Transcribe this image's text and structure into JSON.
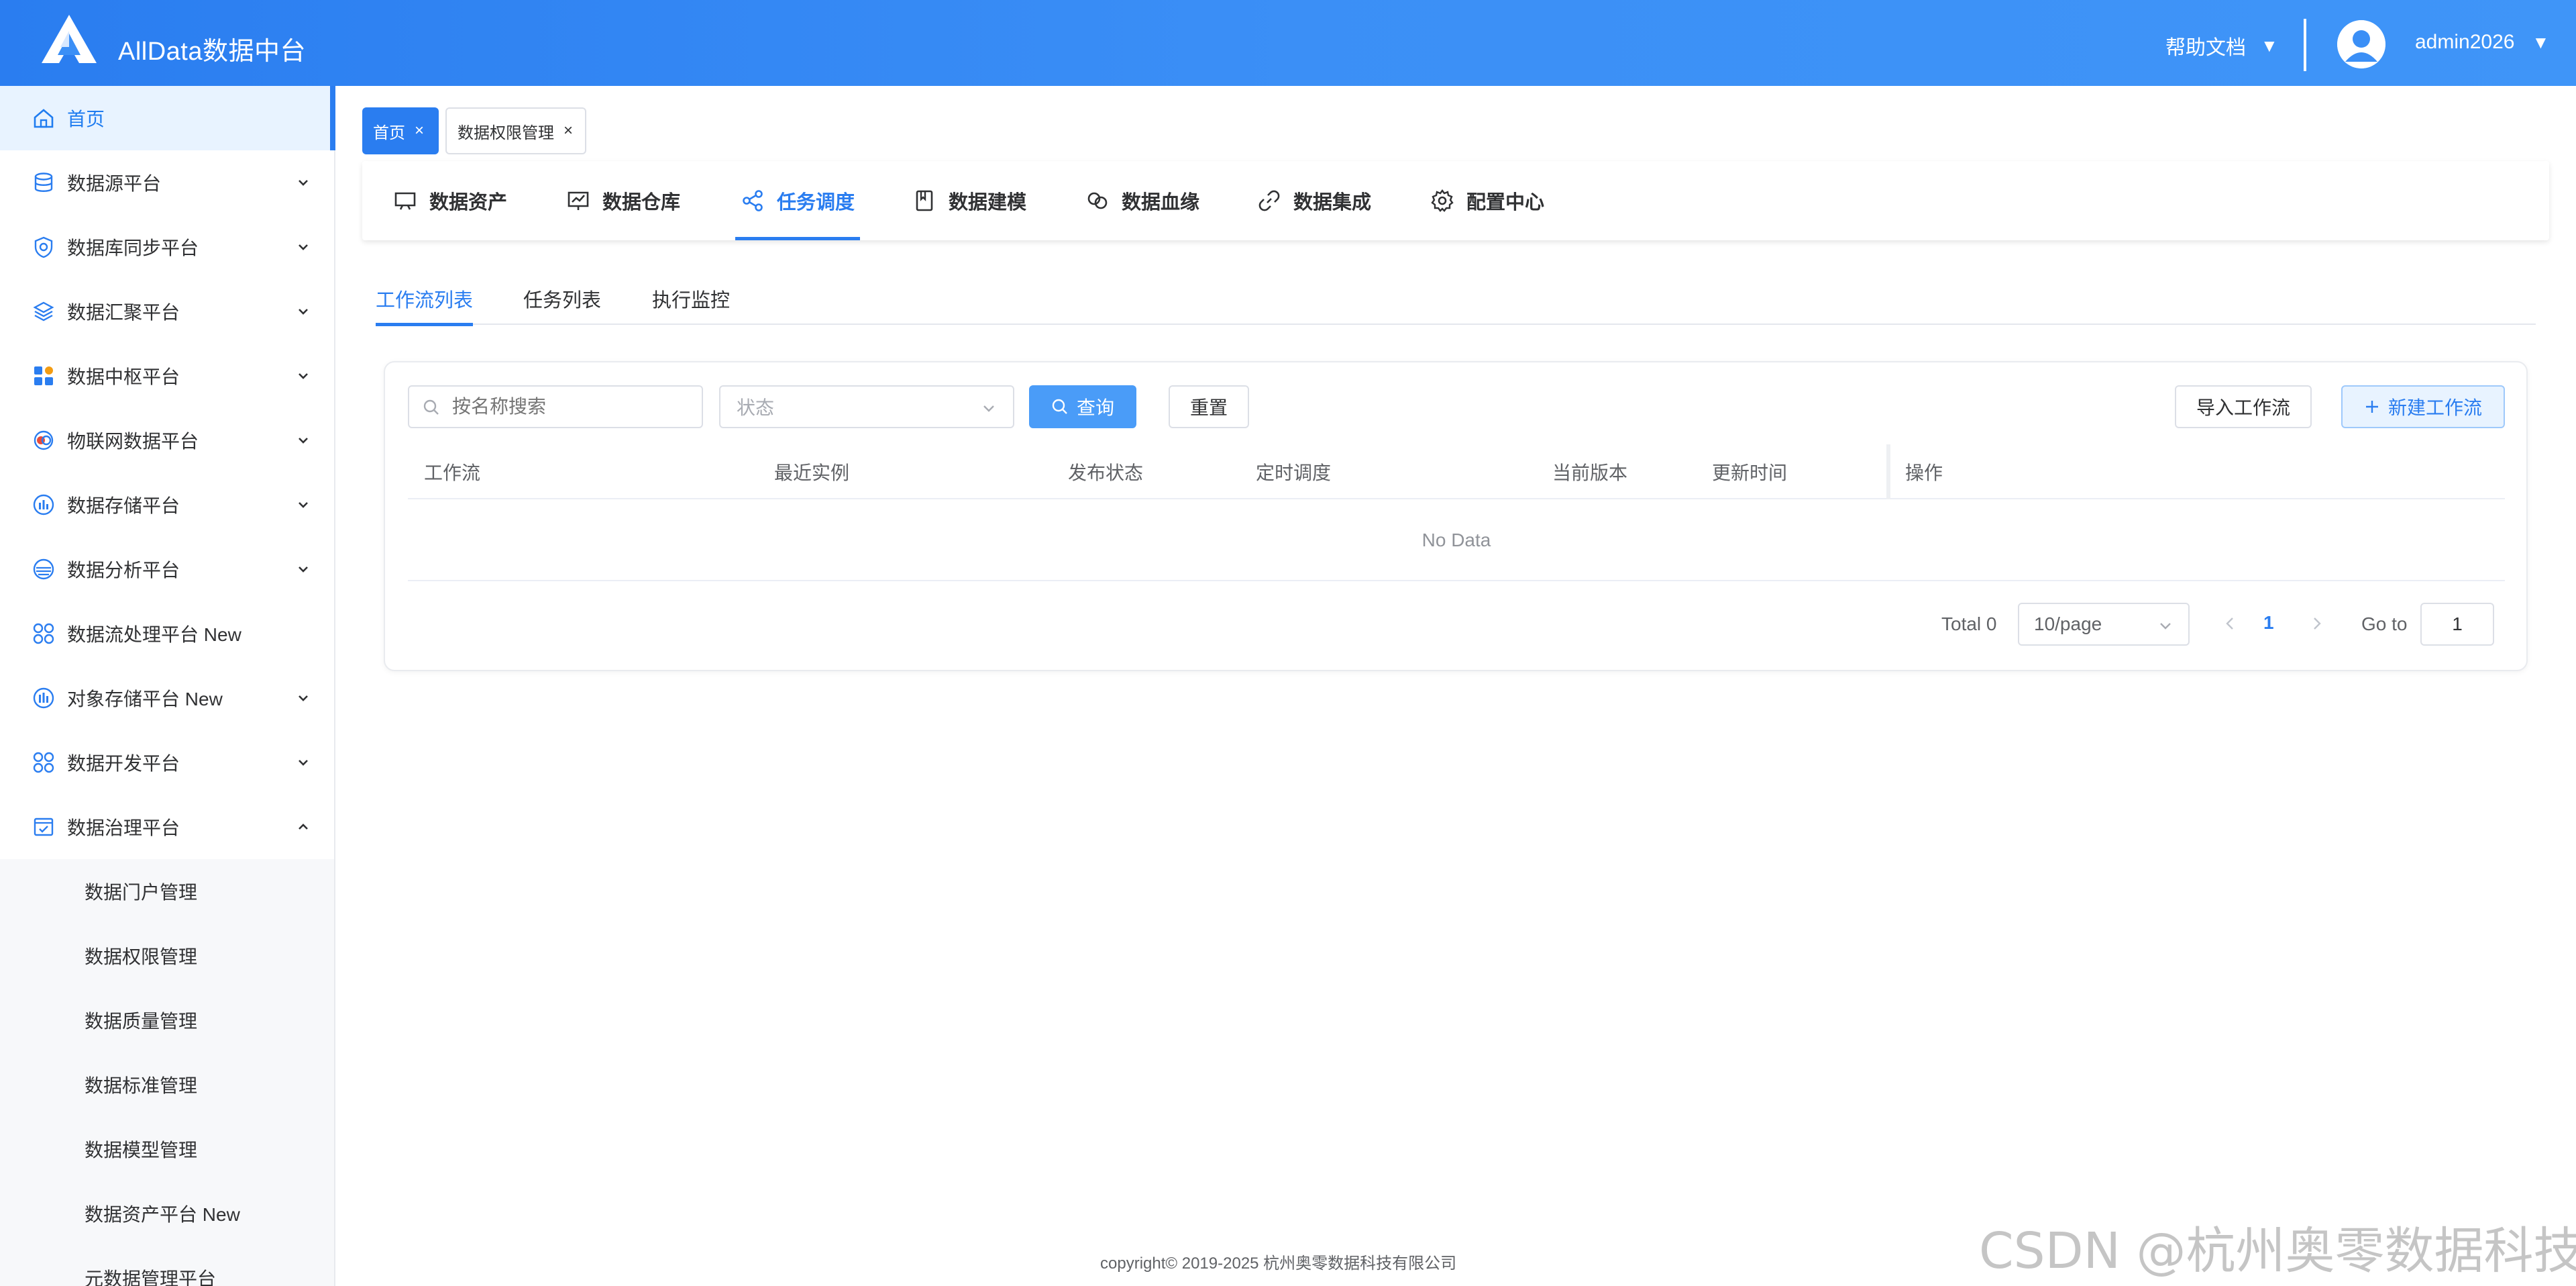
{
  "header": {
    "app_title": "AllData数据中台",
    "help_label": "帮助文档",
    "user_name": "admin2026",
    "caret": "▼"
  },
  "sidebar": {
    "items": [
      {
        "label": "首页",
        "icon": "home-icon",
        "expandable": false,
        "active": true
      },
      {
        "label": "数据源平台",
        "icon": "database-icon",
        "expandable": true
      },
      {
        "label": "数据库同步平台",
        "icon": "shield-sync-icon",
        "expandable": true
      },
      {
        "label": "数据汇聚平台",
        "icon": "layers-icon",
        "expandable": true
      },
      {
        "label": "数据中枢平台",
        "icon": "hub-grid-icon",
        "expandable": true
      },
      {
        "label": "物联网数据平台",
        "icon": "iot-icon",
        "expandable": true
      },
      {
        "label": "数据存储平台",
        "icon": "storage-chart-icon",
        "expandable": true
      },
      {
        "label": "数据分析平台",
        "icon": "analysis-icon",
        "expandable": true
      },
      {
        "label": "数据流处理平台 New",
        "icon": "four-circles-icon",
        "expandable": false
      },
      {
        "label": "对象存储平台 New",
        "icon": "object-storage-icon",
        "expandable": true
      },
      {
        "label": "数据开发平台",
        "icon": "dev-circles-icon",
        "expandable": true
      },
      {
        "label": "数据治理平台",
        "icon": "governance-icon",
        "expandable": true,
        "expanded": true
      }
    ],
    "submenu": [
      "数据门户管理",
      "数据权限管理",
      "数据质量管理",
      "数据标准管理",
      "数据模型管理",
      "数据资产平台 New",
      "元数据管理平台"
    ]
  },
  "tags": {
    "home": "首页",
    "current": "数据权限管理",
    "close": "×"
  },
  "modules": [
    {
      "label": "数据资产",
      "icon": "monitor-icon"
    },
    {
      "label": "数据仓库",
      "icon": "chart-board-icon"
    },
    {
      "label": "任务调度",
      "icon": "share-icon",
      "active": true
    },
    {
      "label": "数据建模",
      "icon": "book-icon"
    },
    {
      "label": "数据血缘",
      "icon": "link-circles-icon"
    },
    {
      "label": "数据集成",
      "icon": "link-icon"
    },
    {
      "label": "配置中心",
      "icon": "gear-icon"
    }
  ],
  "subtabs": {
    "workflow_list": "工作流列表",
    "task_list": "任务列表",
    "exec_monitor": "执行监控"
  },
  "toolbar": {
    "search_placeholder": "按名称搜索",
    "status_placeholder": "状态",
    "query_label": "查询",
    "reset_label": "重置",
    "import_label": "导入工作流",
    "new_label": "新建工作流"
  },
  "table": {
    "columns": [
      "工作流",
      "最近实例",
      "发布状态",
      "定时调度",
      "当前版本",
      "更新时间",
      "操作"
    ],
    "empty_text": "No Data"
  },
  "pagination": {
    "total": "Total 0",
    "page_size": "10/page",
    "current_page": "1",
    "goto_label": "Go to",
    "goto_value": "1"
  },
  "footer": {
    "copyright": "copyright© 2019-2025 杭州奥零数据科技有限公司"
  },
  "watermark": "CSDN @杭州奥零数据科技",
  "colors": {
    "primary": "#2a7df0",
    "header_bg": "#3b8ff6",
    "query_button": "#4a9cf8"
  }
}
